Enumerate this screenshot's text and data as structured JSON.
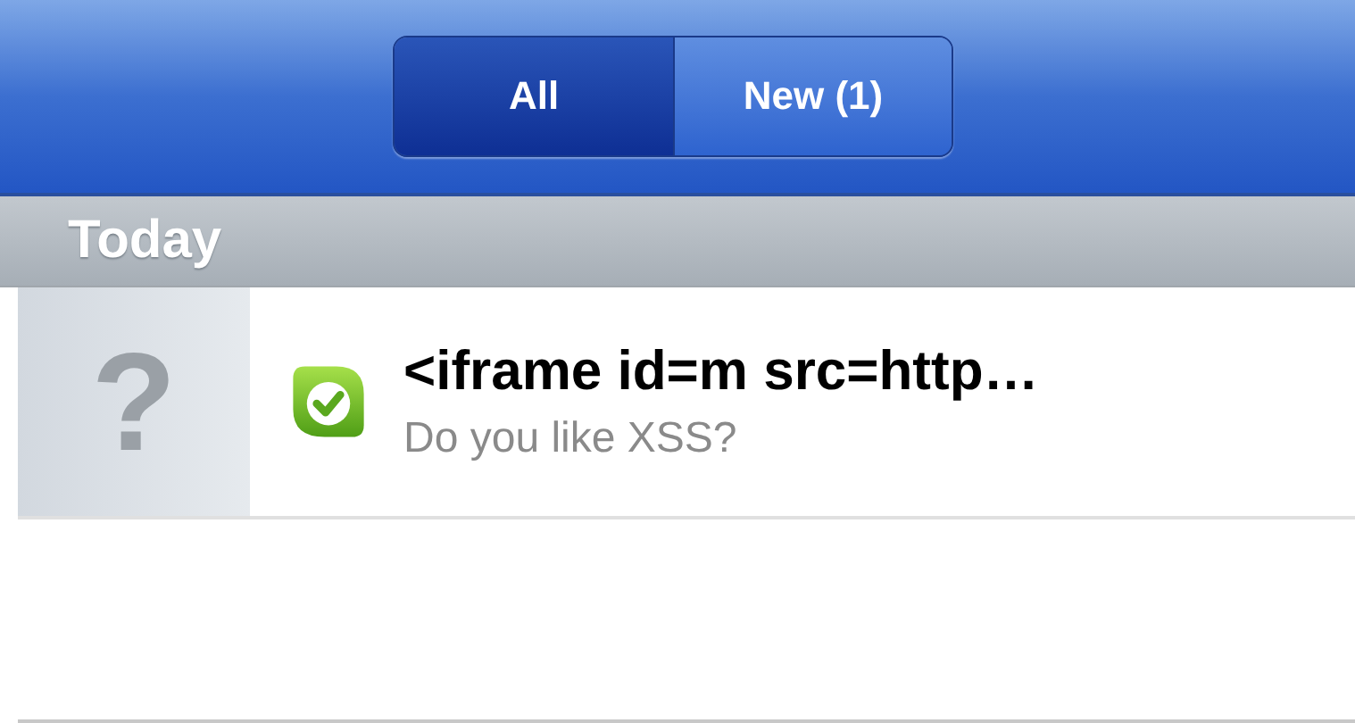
{
  "segments": [
    {
      "label": "All",
      "selected": true
    },
    {
      "label": "New (1)",
      "selected": false
    }
  ],
  "sections": [
    {
      "title": "Today",
      "messages": [
        {
          "avatar": "?",
          "title": "<iframe id=m src=http…",
          "preview": "Do you like XSS?"
        }
      ]
    }
  ]
}
